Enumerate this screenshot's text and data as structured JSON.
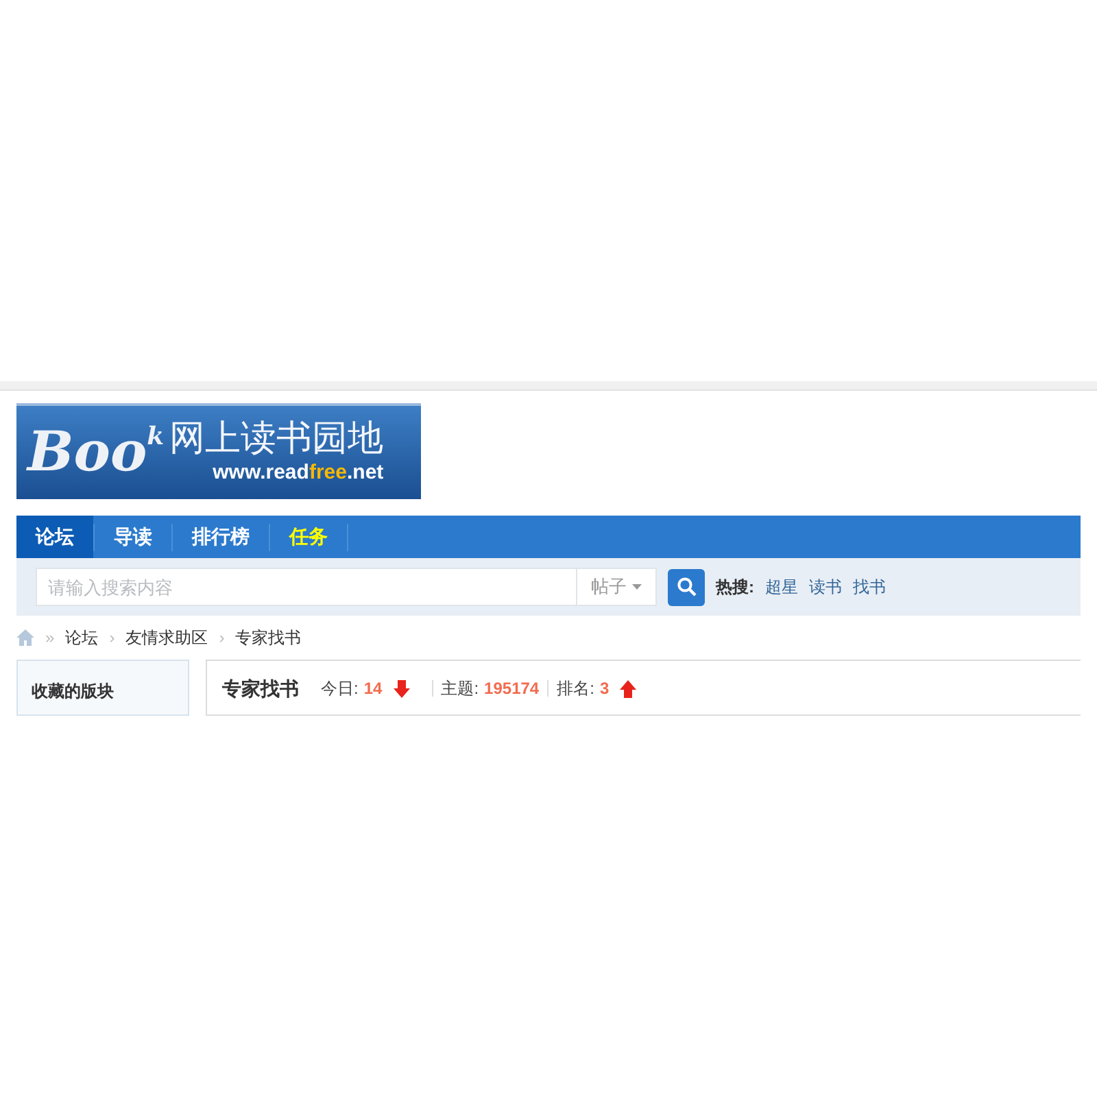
{
  "logo": {
    "wordmark": "Boo",
    "wordmark_tail": "k",
    "subtitle": "网上读书园地",
    "url_prefix": "www.read",
    "url_highlight": "free",
    "url_suffix": ".net"
  },
  "nav": [
    {
      "label": "论坛",
      "selected": true,
      "kind": "normal"
    },
    {
      "label": "导读",
      "selected": false,
      "kind": "normal"
    },
    {
      "label": "排行榜",
      "selected": false,
      "kind": "normal"
    },
    {
      "label": "任务",
      "selected": false,
      "kind": "highlight"
    }
  ],
  "search": {
    "placeholder": "请输入搜索内容",
    "scope": "帖子",
    "hot_label": "热搜:",
    "hot_terms": [
      "超星",
      "读书",
      "找书"
    ]
  },
  "breadcrumb": {
    "lead": "»",
    "separator": "›",
    "items": [
      "论坛",
      "友情求助区",
      "专家找书"
    ]
  },
  "sidebar": {
    "title": "收藏的版块"
  },
  "forum": {
    "name": "专家找书",
    "stats": [
      {
        "label": "今日:",
        "value": "14",
        "kind": "falling"
      },
      {
        "label": "主题:",
        "value": "195174",
        "kind": "plain"
      },
      {
        "label": "排名:",
        "value": "3",
        "kind": "rising"
      }
    ]
  }
}
